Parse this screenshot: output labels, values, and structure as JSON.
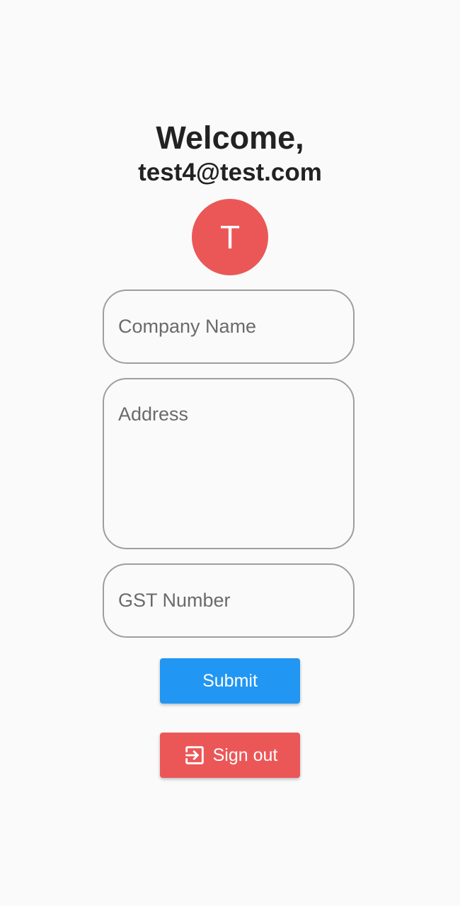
{
  "welcome": {
    "title": "Welcome,",
    "email": "test4@test.com"
  },
  "avatar": {
    "initial": "T"
  },
  "form": {
    "company_placeholder": "Company Name",
    "address_placeholder": "Address",
    "gst_placeholder": "GST Number"
  },
  "actions": {
    "submit_label": "Submit",
    "signout_label": "Sign out",
    "signout_icon": "exit-to-app-icon"
  },
  "colors": {
    "background": "#fafafa",
    "avatar": "#eb5757",
    "submit": "#2196f3",
    "signout": "#eb5757"
  }
}
